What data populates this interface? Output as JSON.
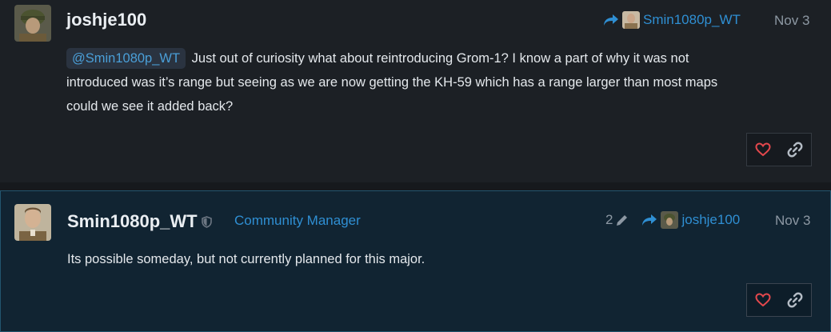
{
  "post1": {
    "username": "joshje100",
    "reply_to_user": "Smin1080p_WT",
    "date": "Nov 3",
    "mention": "@Smin1080p_WT",
    "body_line1": "Just out of curiosity what about reintroducing Grom-1? I know a part of why it was not",
    "body_line2": "introduced was it’s range but seeing as we are now getting the KH-59 which has a range larger than most maps",
    "body_line3": "could we see it added back?"
  },
  "post2": {
    "username": "Smin1080p_WT",
    "role": "Community Manager",
    "edit_count": "2",
    "reply_to_user": "joshje100",
    "date": "Nov 3",
    "body": "Its possible someday, but not currently planned for this major."
  },
  "colors": {
    "accent": "#2f8fd3",
    "like": "#e5484d",
    "highlight_bg": "#112432"
  },
  "icons": [
    "reply-arrow-icon",
    "heart-icon",
    "link-icon",
    "pencil-icon",
    "shield-icon"
  ]
}
